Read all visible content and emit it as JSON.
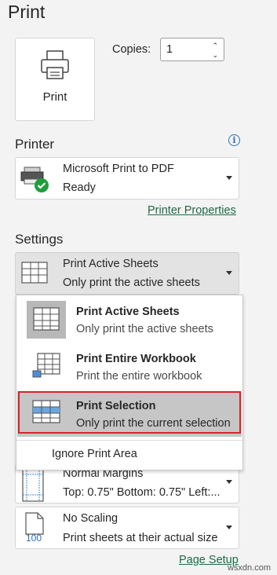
{
  "title": "Print",
  "print_button": {
    "label": "Print",
    "icon": "printer-icon"
  },
  "copies": {
    "label": "Copies:",
    "value": "1"
  },
  "printer": {
    "heading": "Printer",
    "name": "Microsoft Print to PDF",
    "status": "Ready",
    "properties_link": "Printer Properties"
  },
  "settings": {
    "heading": "Settings",
    "selected": {
      "title": "Print Active Sheets",
      "desc": "Only print the active sheets"
    },
    "menu": [
      {
        "title": "Print Active Sheets",
        "desc": "Only print the active sheets"
      },
      {
        "title": "Print Entire Workbook",
        "desc": "Print the entire workbook"
      },
      {
        "title": "Print Selection",
        "desc": "Only print the current selection"
      }
    ],
    "ignore_print_area": "Ignore Print Area",
    "margins": {
      "title": "Normal Margins",
      "desc": "Top: 0.75\" Bottom: 0.75\" Left:..."
    },
    "scaling": {
      "title": "No Scaling",
      "desc": "Print sheets at their actual size",
      "icon_text": "100"
    },
    "page_setup_link": "Page Setup"
  },
  "watermark": "wsxdn.com",
  "colors": {
    "accent_link": "#1e6a45",
    "highlight_border": "#d9232a",
    "info_blue": "#2b6fc2"
  }
}
